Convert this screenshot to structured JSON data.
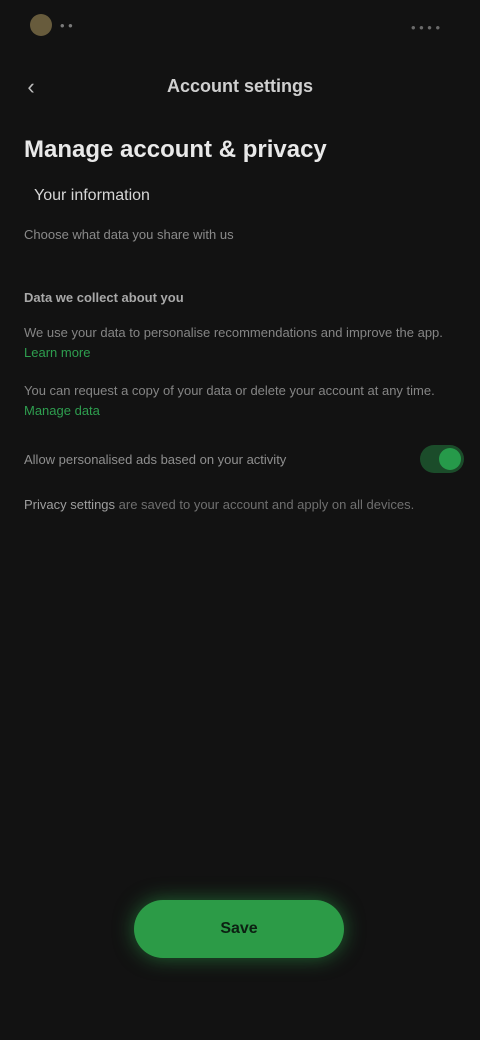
{
  "status": {
    "left_text": "• •",
    "right_text": "• • • •"
  },
  "header": {
    "title": "Account settings"
  },
  "main": {
    "heading": "Manage account & privacy",
    "subheading": "Your information",
    "line": "Choose what data you share with us",
    "section_title": "Data we collect about you",
    "para1": "We use your data to personalise recommendations and improve the app.",
    "para1_link": "Learn more",
    "para2": "You can request a copy of your data or delete your account at any time.",
    "para2_link": "Manage data",
    "option_label": "Allow personalised ads based on your activity",
    "footer_strong": "Privacy settings",
    "footer_rest": " are saved to your account and apply on all devices."
  },
  "actions": {
    "primary_label": "Save"
  },
  "colors": {
    "background": "#121212",
    "accent": "#2c9b47"
  },
  "icons": {
    "back": "back-arrow-icon",
    "toggle": "toggle-switch"
  }
}
